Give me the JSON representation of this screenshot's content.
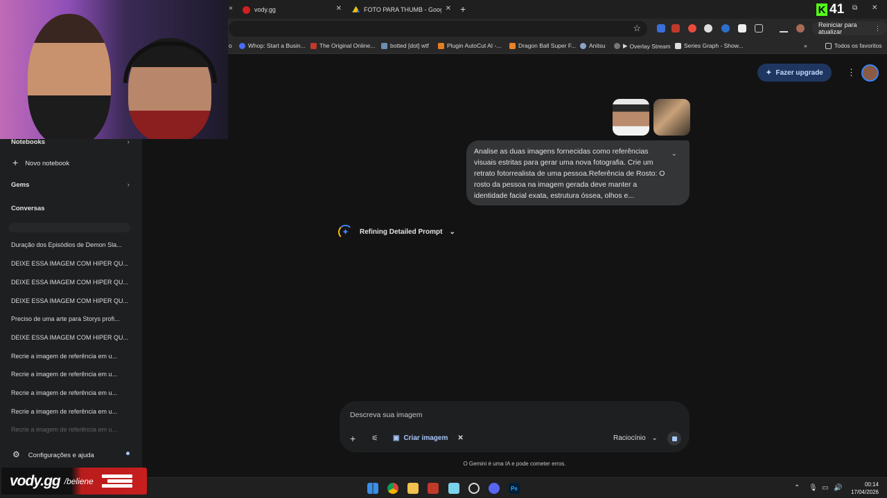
{
  "browser": {
    "tabs": [
      {
        "label": "vody.gg"
      },
      {
        "label": "FOTO PARA THUMB - Google D"
      }
    ],
    "new_tab": "+",
    "kick_count": "41",
    "restart_label": "Reiniciar para atualizar",
    "bookmarks": [
      "Whop: Start a Busin...",
      "The Original Online...",
      "botted [dot] wtf",
      "Plugin AutoCut AI -...",
      "Dragon Ball Super F...",
      "Anitsu",
      "Overlay Stream",
      "Series Graph - Show...",
      "Todos os favoritos"
    ],
    "bookmark_partial": "o"
  },
  "sidebar": {
    "notebooks": "Notebooks",
    "new_notebook": "Novo notebook",
    "gems": "Gems",
    "conversations_header": "Conversas",
    "conversations": [
      "Duração dos Episódios de Demon Sla...",
      "DEIXE ESSA IMAGEM COM HIPER QU...",
      "DEIXE ESSA IMAGEM COM HIPER QU...",
      "DEIXE ESSA IMAGEM COM HIPER QU...",
      "Preciso de uma arte para Storys profi...",
      "DEIXE ESSA IMAGEM COM HIPER QU...",
      "Recrie a imagem de referência em u...",
      "Recrie a imagem de referência em u...",
      "Recrie a imagem de referência em u...",
      "Recrie a imagem de referência em u...",
      "Recrie a imagem de referência em u..."
    ],
    "settings": "Configurações e ajuda"
  },
  "main": {
    "upgrade_label": "Fazer upgrade",
    "user_message": "Analise as duas imagens fornecidas como referências visuais estritas para gerar uma nova fotografia. Crie um retrato fotorrealista de uma pessoa.Referência de Rosto: O rosto da pessoa na imagem gerada deve manter a identidade facial exata, estrutura óssea, olhos e...",
    "thinking_label": "Refining Detailed Prompt",
    "composer": {
      "placeholder": "Descreva sua imagem",
      "tool_chip": "Criar imagem",
      "model": "Raciocínio"
    },
    "disclaimer": "O Gemini é uma IA e pode cometer erros."
  },
  "taskbar": {
    "time": "00:14",
    "date": "17/04/2026"
  },
  "watermark": {
    "brand": "vody.gg",
    "handle": "/beliene"
  },
  "colors": {
    "accent": "#a8c7fa",
    "upgrade_bg": "#1f3760",
    "kick_green": "#53fc18"
  }
}
